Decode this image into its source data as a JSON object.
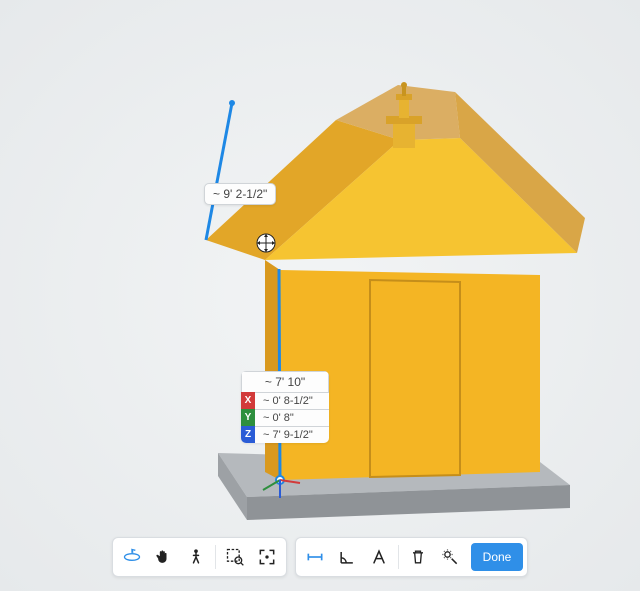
{
  "measurements": {
    "roof_edge": "~ 9' 2-1/2\"",
    "wall_edge": "~ 7' 10\"",
    "delta_x": "~ 0' 8-1/2\"",
    "delta_y": "~ 0' 8\"",
    "delta_z": "~ 7' 9-1/2\"",
    "axis_x": "X",
    "axis_y": "Y",
    "axis_z": "Z"
  },
  "toolbar": {
    "nav": {
      "orbit": "orbit",
      "pan": "pan",
      "walk": "walk",
      "zoom_region": "zoom-region",
      "zoom_fit": "zoom-fit"
    },
    "measure": {
      "distance": "distance",
      "angle": "angle",
      "annotate": "annotate",
      "delete": "delete",
      "settings": "settings",
      "done_label": "Done"
    }
  },
  "colors": {
    "accent": "#2f8fe8",
    "measure_line": "#1e88e5",
    "model_fill_light": "#f6c431",
    "model_fill_mid": "#e8a21f",
    "model_fill_dark": "#cf8f1a",
    "base_fill": "#b2b6ba",
    "axis_x": "#d23a3a",
    "axis_y": "#2e8f3e",
    "axis_z": "#2a5cd6"
  }
}
